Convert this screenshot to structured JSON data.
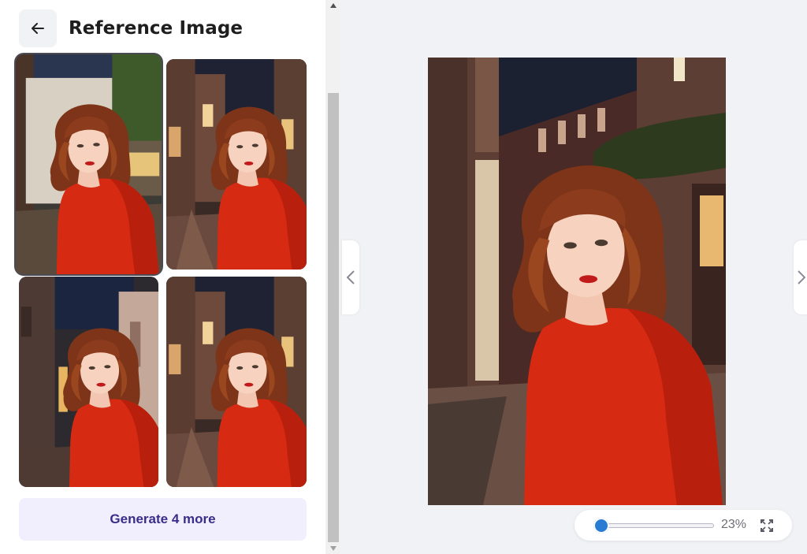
{
  "header": {
    "title": "Reference Image",
    "back_icon": "arrow-left-icon"
  },
  "gallery": {
    "selected_index": 0,
    "thumbnails": [
      {
        "label": "Generated image 1"
      },
      {
        "label": "Generated image 2"
      },
      {
        "label": "Generated image 3"
      },
      {
        "label": "Generated image 4"
      }
    ]
  },
  "actions": {
    "generate_label": "Generate 4 more"
  },
  "viewer": {
    "prev_icon": "chevron-left-icon",
    "next_icon": "chevron-right-icon"
  },
  "zoom": {
    "value": 23,
    "label": "23%",
    "fullscreen_icon": "expand-icon"
  },
  "colors": {
    "accent": "#2a7bd4",
    "button_bg": "#f1effd",
    "button_text": "#3a2c8a",
    "sweater": "#d62a12",
    "hair": "#8a3a1c"
  }
}
